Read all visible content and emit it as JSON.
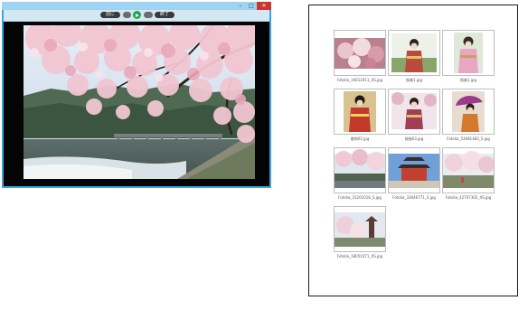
{
  "viewer": {
    "titlebar_buttons": {
      "minimize": "–",
      "maximize": "□",
      "close": "✕"
    },
    "toolbar": {
      "prev_label": "前に",
      "play_icon": "play-icon",
      "next_label": "次に",
      "close_label": "終了"
    }
  },
  "thumbnails": [
    {
      "caption": "Fotolia_34012011_XS.jpg"
    },
    {
      "caption": "振袖1.jpg"
    },
    {
      "caption": "振袖1.jpg"
    },
    {
      "caption": "着物02.jpg"
    },
    {
      "caption": "振袖03.jpg"
    },
    {
      "caption": "Fotolia_53081483_S.jpg"
    },
    {
      "caption": "Fotolia_31201018_S.jpg"
    },
    {
      "caption": "Fotolia_33646771_S.jpg"
    },
    {
      "caption": "Fotolia_42707302_XS.jpg"
    },
    {
      "caption": "Fotolia_18051071_XS.jpg"
    }
  ],
  "colors": {
    "window_frame": "#3aa3e0",
    "stage": "#050505",
    "play": "#27a24a",
    "close": "#c7372f"
  }
}
